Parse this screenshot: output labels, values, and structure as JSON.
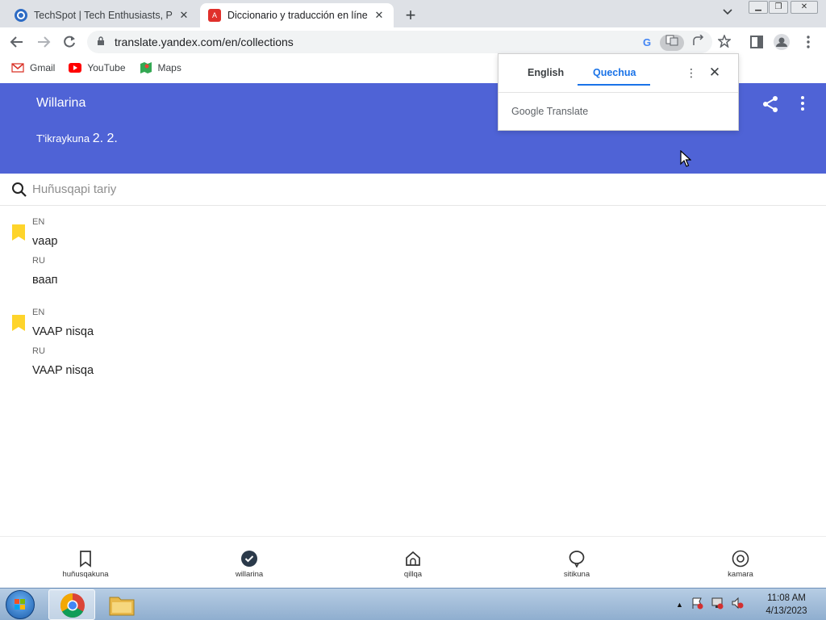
{
  "browser": {
    "tabs": [
      {
        "title": "TechSpot | Tech Enthusiasts, Pow",
        "favicon": "techspot-icon",
        "active": false
      },
      {
        "title": "Diccionario y traducción en línea",
        "favicon": "yandex-translate-icon",
        "active": true
      }
    ],
    "url": "translate.yandex.com/en/collections"
  },
  "bookmarks": [
    {
      "label": "Gmail",
      "icon": "gmail-icon"
    },
    {
      "label": "YouTube",
      "icon": "youtube-icon"
    },
    {
      "label": "Maps",
      "icon": "maps-icon"
    }
  ],
  "header": {
    "title": "Willarina",
    "subtitle_label": "T'ikraykuna",
    "subtitle_value": "2. 2."
  },
  "search": {
    "placeholder": "Huñusqapi tariy"
  },
  "entries": [
    {
      "source_lang": "EN",
      "source_text": "vaap",
      "target_lang": "RU",
      "target_text": "ваап"
    },
    {
      "source_lang": "EN",
      "source_text": "VAAP nisqa",
      "target_lang": "RU",
      "target_text": "VAAP nisqa"
    }
  ],
  "bottom_nav": [
    {
      "label": "huñusqakuna",
      "icon": "bookmark-icon"
    },
    {
      "label": "willarina",
      "icon": "check-circle-icon"
    },
    {
      "label": "qillqa",
      "icon": "home-icon"
    },
    {
      "label": "sitikuna",
      "icon": "speech-bubble-icon"
    },
    {
      "label": "kamara",
      "icon": "camera-icon"
    }
  ],
  "translate_popup": {
    "source_lang": "English",
    "target_lang": "Quechua",
    "brand_google": "Google",
    "brand_translate": "Translate"
  },
  "taskbar": {
    "time": "11:08 AM",
    "date": "4/13/2023"
  },
  "colors": {
    "header_bg": "#4f63d6",
    "bookmark_yellow": "#fed42b",
    "accent_blue": "#1a73e8"
  }
}
